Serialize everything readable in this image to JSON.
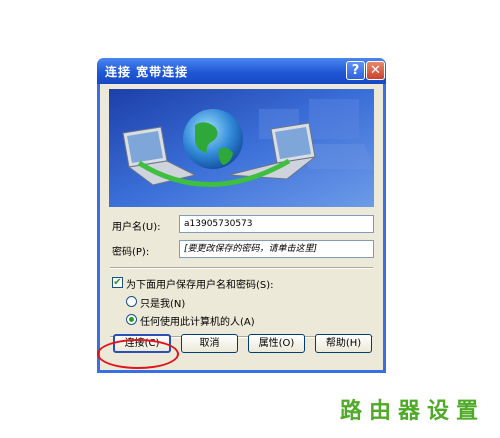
{
  "window": {
    "title": "连接 宽带连接",
    "help_label": "?",
    "close_label": "✕"
  },
  "form": {
    "username_label": "用户名(U):",
    "username_value": "a13905730573",
    "password_label": "密码(P):",
    "password_placeholder": "[要更改保存的密码，请单击这里]",
    "save_checkbox_label": "为下面用户保存用户名和密码(S):",
    "save_checked": true,
    "radio_me_label": "只是我(N)",
    "radio_anyone_label": "任何使用此计算机的人(A)",
    "selected_radio": "anyone"
  },
  "buttons": {
    "connect": "连接(C)",
    "cancel": "取消",
    "properties": "属性(O)",
    "help": "帮助(H)"
  },
  "watermark": "路由器设置",
  "colors": {
    "titlebar": "#1f58d6",
    "client": "#ece9d8",
    "highlight_ring": "#e0141c",
    "watermark": "#4faa28"
  },
  "icons": {
    "banner": "globe-with-two-laptops-illustration",
    "check": "checkmark-icon"
  }
}
